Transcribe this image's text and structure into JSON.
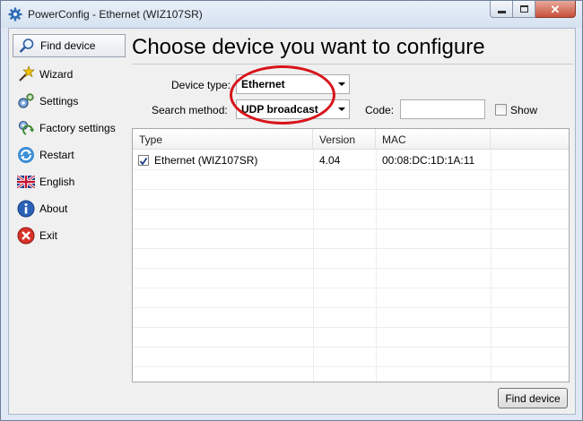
{
  "window": {
    "title": "PowerConfig - Ethernet (WIZ107SR)"
  },
  "sidebar": {
    "items": [
      {
        "label": "Find device",
        "icon": "magnifier-icon",
        "active": true
      },
      {
        "label": "Wizard",
        "icon": "wizard-icon"
      },
      {
        "label": "Settings",
        "icon": "gears-icon"
      },
      {
        "label": "Factory settings",
        "icon": "factory-reset-icon"
      },
      {
        "label": "Restart",
        "icon": "restart-icon"
      },
      {
        "label": "English",
        "icon": "uk-flag-icon"
      },
      {
        "label": "About",
        "icon": "info-icon"
      },
      {
        "label": "Exit",
        "icon": "exit-icon"
      }
    ]
  },
  "main": {
    "heading": "Choose device you want to configure",
    "device_type_label": "Device type:",
    "device_type_value": "Ethernet",
    "search_method_label": "Search method:",
    "search_method_value": "UDP broadcast",
    "code_label": "Code:",
    "code_value": "",
    "show_label": "Show",
    "show_checked": false
  },
  "table": {
    "columns": [
      "Type",
      "Version",
      "MAC"
    ],
    "rows": [
      {
        "checked": true,
        "type": "Ethernet (WIZ107SR)",
        "version": "4.04",
        "mac": "00:08:DC:1D:1A:11"
      }
    ]
  },
  "footer": {
    "find_button_label": "Find device"
  },
  "colors": {
    "annotation_ellipse": "#d8141b",
    "title_bar": "#dfe8f4"
  }
}
